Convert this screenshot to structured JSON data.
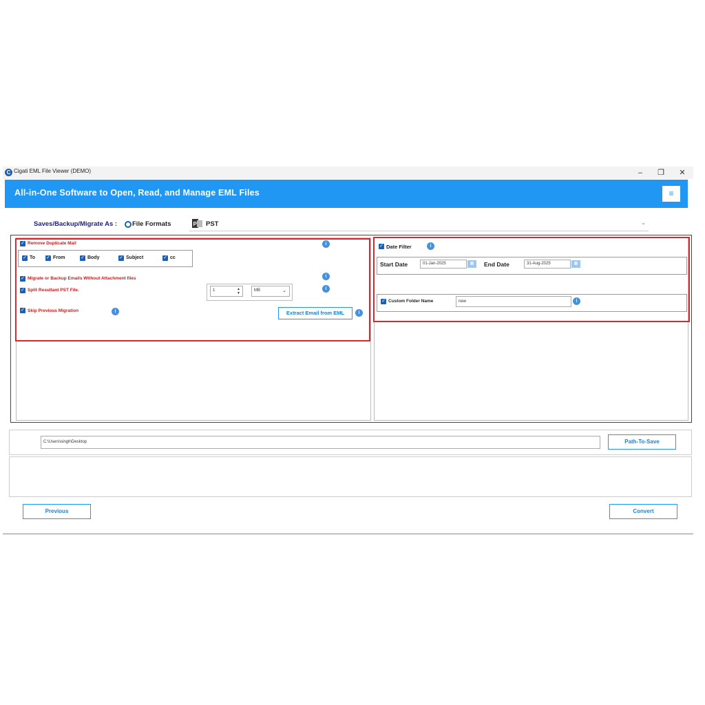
{
  "window": {
    "title": "Cigati EML File Viewer (DEMO)",
    "logo_letter": "C",
    "minimize": "–",
    "restore": "❐",
    "close": "✕"
  },
  "header": {
    "title": "All-in-One Software to Open, Read, and Manage EML Files",
    "menu_icon": "≡"
  },
  "format": {
    "label": "Saves/Backup/Migrate As :",
    "radio_label": "File Formats",
    "selected": "PST",
    "chevron": "⌄"
  },
  "options": {
    "remove_duplicate": "Remove Duplicate Mail",
    "fields": [
      "To",
      "From",
      "Body",
      "Subject",
      "cc"
    ],
    "without_attachment": "Migrate or Backup Emails Without Attachment files",
    "split_pst": "Split Resultant PST File.",
    "split_value": "1",
    "split_unit": "MB",
    "skip_previous": "Skip Previous Migration",
    "extract_button": "Extract Email from EML"
  },
  "filters": {
    "date_filter": "Date Filter",
    "start_label": "Start Date",
    "start_value": "01-Jan-2025",
    "end_label": "End Date",
    "end_value": "31-Aug-2025",
    "custom_folder": "Custom Folder Name",
    "custom_folder_value": "new"
  },
  "save": {
    "path": "C:\\Users\\singh\\Desktop",
    "button": "Path-To-Save"
  },
  "footer": {
    "previous": "Previous",
    "convert": "Convert"
  },
  "colors": {
    "banner": "#1f97f3",
    "highlight": "#d6262e",
    "checkbox": "#1d5fb4"
  }
}
